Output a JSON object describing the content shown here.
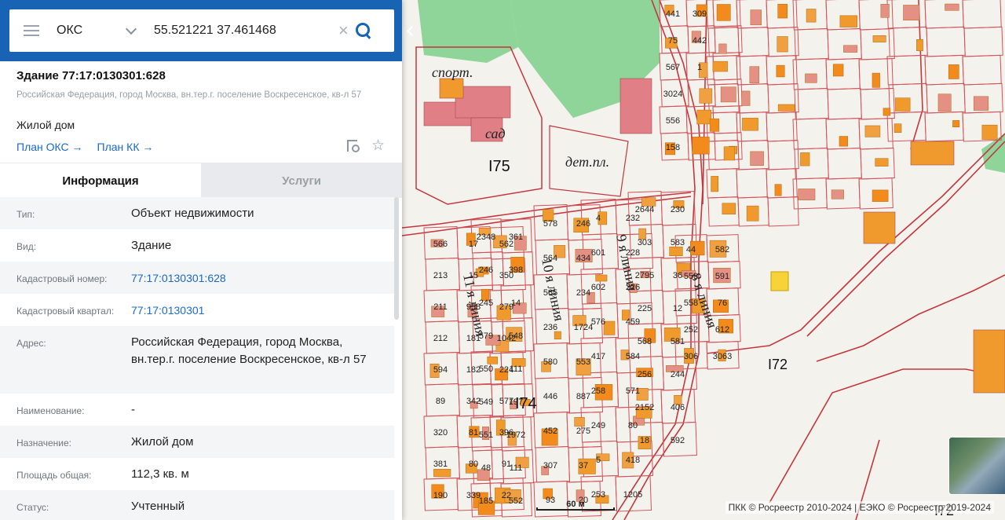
{
  "search": {
    "type_label": "ОКС",
    "query": "55.521221 37.461468"
  },
  "object": {
    "title": "Здание 77:17:0130301:628",
    "address": "Российская Федерация, город Москва, вн.тер.г. поселение Воскресенское, кв-л 57",
    "purpose": "Жилой дом",
    "links": [
      "План ОКС →",
      "План КК →"
    ]
  },
  "tabs": [
    {
      "label": "Информация",
      "active": true
    },
    {
      "label": "Услуги",
      "active": false
    }
  ],
  "info_rows": [
    {
      "key": "Тип:",
      "value": "Объект недвижимости",
      "link": false
    },
    {
      "key": "Вид:",
      "value": "Здание",
      "link": false
    },
    {
      "key": "Кадастровый номер:",
      "value": "77:17:0130301:628",
      "link": true
    },
    {
      "key": "Кадастровый квартал:",
      "value": "77:17:0130301",
      "link": true
    },
    {
      "key": "Адрес:",
      "value": "Российская Федерация, город Москва, вн.тер.г. поселение Воскресенское, кв-л 57",
      "link": false
    },
    {
      "key": "Наименование:",
      "value": "-",
      "link": false
    },
    {
      "key": "Назначение:",
      "value": "Жилой дом",
      "link": false
    },
    {
      "key": "Площадь общая:",
      "value": "112,3 кв. м",
      "link": false
    },
    {
      "key": "Статус:",
      "value": "Учтенный",
      "link": false
    }
  ],
  "map": {
    "scale_label": "60 м",
    "copyright": "ПКК © Росреестр 2010-2024 | ЕЭКО © Росреестр 2019-2024",
    "big_labels": [
      "I75",
      "I74",
      "I72",
      "I72"
    ],
    "italic_labels": [
      "спорт.",
      "сад",
      "дет.пл."
    ],
    "street_labels": [
      "11 я линия",
      "10 я линия",
      "9 я линия",
      "8 я линия"
    ],
    "parcel_numbers": [
      "566",
      "213",
      "211",
      "212",
      "594",
      "89",
      "320",
      "381",
      "190",
      "17",
      "15",
      "958",
      "181",
      "182",
      "342",
      "81",
      "80",
      "339",
      "562",
      "350",
      "279",
      "1042",
      "224",
      "577",
      "396",
      "91",
      "22",
      "2348",
      "246",
      "245",
      "579",
      "550",
      "549",
      "551",
      "48",
      "185",
      "361",
      "398",
      "14",
      "548",
      "111",
      "197",
      "1972",
      "111",
      "552",
      "578",
      "564",
      "565",
      "236",
      "580",
      "446",
      "452",
      "307",
      "93",
      "246",
      "434",
      "234",
      "1724",
      "553",
      "887",
      "275",
      "37",
      "20",
      "4",
      "601",
      "602",
      "576",
      "417",
      "258",
      "249",
      "5",
      "253",
      "232",
      "228",
      "226",
      "459",
      "584",
      "571",
      "80",
      "418",
      "1205",
      "2644",
      "303",
      "2795",
      "225",
      "568",
      "256",
      "2152",
      "18",
      "230",
      "583",
      "36",
      "12",
      "581",
      "244",
      "406",
      "592",
      "44",
      "559",
      "558",
      "252",
      "306",
      "582",
      "591",
      "76",
      "612",
      "3063",
      "441",
      "75",
      "567",
      "3024",
      "556",
      "158",
      "309",
      "442",
      "1"
    ]
  }
}
